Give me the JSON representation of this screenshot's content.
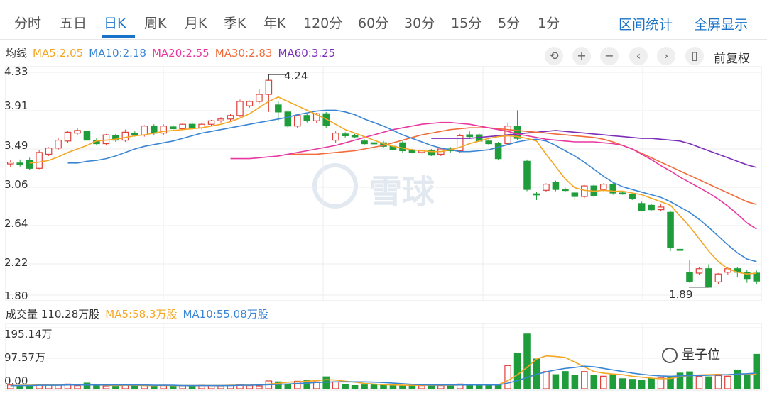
{
  "tabs": [
    {
      "label": "分时"
    },
    {
      "label": "五日"
    },
    {
      "label": "日K"
    },
    {
      "label": "周K"
    },
    {
      "label": "月K"
    },
    {
      "label": "季K"
    },
    {
      "label": "年K"
    },
    {
      "label": "120分"
    },
    {
      "label": "60分"
    },
    {
      "label": "30分"
    },
    {
      "label": "15分"
    },
    {
      "label": "5分"
    },
    {
      "label": "1分"
    }
  ],
  "active_tab": "日K",
  "links": {
    "interval_stats": "区间统计",
    "fullscreen": "全屏显示"
  },
  "ma_legend": {
    "title": "均线",
    "ma5": "MA5:2.05",
    "ma10": "MA10:2.18",
    "ma20": "MA20:2.55",
    "ma30": "MA30:2.83",
    "ma60": "MA60:3.25"
  },
  "colors": {
    "ma5": "#f5a623",
    "ma10": "#3b86d4",
    "ma20": "#e8379f",
    "ma30": "#f26b3a",
    "ma60": "#7b2fb8",
    "up": "#e0413a",
    "down": "#1f9d3a",
    "accent": "#1a73c9"
  },
  "toolbar": {
    "reset_glyph": "⟲",
    "zoom_in_glyph": "+",
    "zoom_out_glyph": "−",
    "prev_glyph": "‹",
    "next_glyph": "›",
    "bar_glyph": "▯",
    "adjust_label": "前复权"
  },
  "price_axis": [
    "4.33",
    "3.91",
    "3.49",
    "3.06",
    "2.64",
    "2.22",
    "1.80"
  ],
  "annotations": {
    "high": "4.24",
    "low": "1.89"
  },
  "volume_header": {
    "label": "成交量 110.28万股",
    "ma5": "MA5:58.3万股",
    "ma10": "MA10:55.08万股"
  },
  "volume_axis": [
    "195.14万",
    "97.57万",
    "0.00"
  ],
  "watermark": "雪球",
  "brand": "量子位",
  "chart_data": {
    "type": "candlestick",
    "ylim": [
      1.8,
      4.33
    ],
    "candles": [
      [
        3.29,
        3.31,
        3.27,
        3.25,
        3.33
      ],
      [
        3.3,
        3.28,
        3.33,
        3.26,
        3.34
      ],
      [
        3.33,
        3.24,
        3.35,
        3.22,
        3.36
      ],
      [
        3.24,
        3.42,
        3.24,
        3.23,
        3.45
      ],
      [
        3.4,
        3.47,
        3.39,
        3.38,
        3.48
      ],
      [
        3.47,
        3.56,
        3.46,
        3.45,
        3.58
      ],
      [
        3.55,
        3.65,
        3.54,
        3.53,
        3.66
      ],
      [
        3.64,
        3.67,
        3.63,
        3.62,
        3.7
      ],
      [
        3.66,
        3.56,
        3.68,
        3.4,
        3.69
      ],
      [
        3.56,
        3.52,
        3.57,
        3.5,
        3.58
      ],
      [
        3.52,
        3.62,
        3.51,
        3.5,
        3.63
      ],
      [
        3.61,
        3.56,
        3.62,
        3.54,
        3.63
      ],
      [
        3.56,
        3.65,
        3.55,
        3.54,
        3.68
      ],
      [
        3.64,
        3.62,
        3.65,
        3.6,
        3.66
      ],
      [
        3.62,
        3.72,
        3.61,
        3.6,
        3.73
      ],
      [
        3.72,
        3.64,
        3.73,
        3.62,
        3.74
      ],
      [
        3.64,
        3.72,
        3.63,
        3.62,
        3.74
      ],
      [
        3.71,
        3.69,
        3.72,
        3.67,
        3.73
      ],
      [
        3.69,
        3.74,
        3.68,
        3.67,
        3.75
      ],
      [
        3.74,
        3.7,
        3.75,
        3.68,
        3.77
      ],
      [
        3.7,
        3.74,
        3.69,
        3.68,
        3.76
      ],
      [
        3.74,
        3.78,
        3.73,
        3.72,
        3.79
      ],
      [
        3.78,
        3.8,
        3.77,
        3.76,
        3.82
      ],
      [
        3.8,
        3.84,
        3.79,
        3.78,
        3.86
      ],
      [
        3.84,
        4.0,
        3.83,
        3.82,
        4.02
      ],
      [
        3.95,
        4.0,
        3.94,
        3.93,
        4.01
      ],
      [
        4.0,
        4.08,
        3.99,
        3.98,
        4.14
      ],
      [
        4.08,
        4.24,
        3.9,
        3.88,
        4.24
      ],
      [
        3.96,
        3.88,
        3.97,
        3.78,
        4.0
      ],
      [
        3.88,
        3.72,
        3.89,
        3.7,
        3.9
      ],
      [
        3.72,
        3.84,
        3.71,
        3.7,
        3.86
      ],
      [
        3.84,
        3.78,
        3.85,
        3.76,
        3.86
      ],
      [
        3.78,
        3.86,
        3.77,
        3.75,
        3.87
      ],
      [
        3.86,
        3.73,
        3.87,
        3.7,
        3.88
      ],
      [
        3.56,
        3.64,
        3.55,
        3.53,
        3.66
      ],
      [
        3.63,
        3.61,
        3.64,
        3.59,
        3.65
      ],
      [
        3.61,
        3.6,
        3.62,
        3.58,
        3.63
      ],
      [
        3.55,
        3.52,
        3.56,
        3.5,
        3.57
      ],
      [
        3.53,
        3.52,
        3.54,
        3.44,
        3.55
      ],
      [
        3.53,
        3.49,
        3.54,
        3.47,
        3.55
      ],
      [
        3.49,
        3.45,
        3.5,
        3.43,
        3.51
      ],
      [
        3.53,
        3.44,
        3.54,
        3.42,
        3.55
      ],
      [
        3.44,
        3.42,
        3.45,
        3.41,
        3.46
      ],
      [
        3.42,
        3.44,
        3.43,
        3.41,
        3.45
      ],
      [
        3.44,
        3.39,
        3.45,
        3.38,
        3.46
      ],
      [
        3.4,
        3.46,
        3.39,
        3.38,
        3.47
      ],
      [
        3.46,
        3.44,
        3.47,
        3.42,
        3.48
      ],
      [
        3.44,
        3.61,
        3.43,
        3.42,
        3.63
      ],
      [
        3.62,
        3.6,
        3.63,
        3.58,
        3.66
      ],
      [
        3.62,
        3.55,
        3.63,
        3.54,
        3.64
      ],
      [
        3.55,
        3.52,
        3.56,
        3.5,
        3.57
      ],
      [
        3.52,
        3.35,
        3.53,
        3.33,
        3.54
      ],
      [
        3.52,
        3.72,
        3.51,
        3.5,
        3.76
      ],
      [
        3.72,
        3.58,
        3.73,
        3.56,
        3.9
      ],
      [
        3.32,
        3.0,
        3.33,
        2.98,
        3.34
      ],
      [
        2.95,
        2.94,
        2.96,
        2.88,
        2.97
      ],
      [
        2.99,
        3.06,
        2.98,
        2.97,
        3.07
      ],
      [
        3.08,
        3.0,
        3.09,
        2.98,
        3.1
      ],
      [
        3.0,
        2.99,
        3.01,
        2.97,
        3.02
      ],
      [
        2.96,
        2.92,
        2.97,
        2.88,
        2.98
      ],
      [
        2.92,
        3.04,
        2.91,
        2.9,
        3.05
      ],
      [
        3.04,
        2.93,
        3.05,
        2.91,
        3.06
      ],
      [
        3.0,
        3.06,
        2.99,
        2.98,
        3.07
      ],
      [
        3.06,
        2.96,
        3.07,
        2.94,
        3.08
      ],
      [
        2.96,
        2.95,
        2.97,
        2.94,
        2.98
      ],
      [
        2.94,
        2.9,
        2.95,
        2.88,
        2.96
      ],
      [
        2.84,
        2.76,
        2.85,
        2.75,
        2.86
      ],
      [
        2.82,
        2.77,
        2.83,
        2.76,
        2.84
      ],
      [
        2.77,
        2.8,
        2.76,
        2.75,
        2.83
      ],
      [
        2.74,
        2.34,
        2.75,
        2.3,
        2.76
      ],
      [
        2.32,
        2.31,
        2.33,
        2.1,
        2.34
      ],
      [
        2.06,
        1.95,
        2.07,
        1.94,
        2.2
      ],
      [
        2.05,
        2.1,
        2.04,
        2.03,
        2.12
      ],
      [
        2.1,
        1.89,
        2.11,
        1.89,
        2.15
      ],
      [
        1.95,
        2.04,
        1.94,
        1.92,
        2.05
      ],
      [
        2.06,
        2.1,
        2.05,
        2.03,
        2.12
      ],
      [
        2.1,
        2.06,
        2.09,
        2.0,
        2.12
      ],
      [
        2.06,
        1.98,
        2.07,
        1.94,
        2.09
      ],
      [
        2.05,
        1.96,
        2.06,
        1.92,
        2.08
      ]
    ],
    "ma": {
      "ma5": [
        3.3,
        3.31,
        3.33,
        3.37,
        3.42,
        3.46,
        3.5,
        3.55,
        3.56,
        3.57,
        3.59,
        3.61,
        3.62,
        3.64,
        3.66,
        3.67,
        3.68,
        3.69,
        3.7,
        3.72,
        3.74,
        3.77,
        3.81,
        3.86,
        3.93,
        4.0,
        4.05,
        4.0,
        3.95,
        3.9,
        3.85,
        3.8,
        3.74,
        3.68,
        3.64,
        3.6,
        3.56,
        3.52,
        3.49,
        3.47,
        3.45,
        3.44,
        3.43,
        3.43,
        3.45,
        3.48,
        3.52,
        3.55,
        3.58,
        3.6,
        3.61,
        3.6,
        3.58,
        3.55,
        3.4,
        3.26,
        3.12,
        3.02,
        2.99,
        2.98,
        2.99,
        2.98,
        2.98,
        2.96,
        2.94,
        2.9,
        2.86,
        2.82,
        2.7,
        2.58,
        2.44,
        2.3,
        2.18,
        2.1,
        2.06,
        2.04,
        2.05
      ],
      "ma10": [
        3.3,
        3.3,
        3.32,
        3.33,
        3.35,
        3.38,
        3.42,
        3.46,
        3.49,
        3.51,
        3.53,
        3.55,
        3.58,
        3.61,
        3.64,
        3.66,
        3.68,
        3.7,
        3.72,
        3.74,
        3.76,
        3.78,
        3.8,
        3.82,
        3.85,
        3.87,
        3.89,
        3.9,
        3.9,
        3.88,
        3.85,
        3.8,
        3.76,
        3.72,
        3.67,
        3.62,
        3.58,
        3.54,
        3.5,
        3.47,
        3.45,
        3.43,
        3.43,
        3.44,
        3.45,
        3.48,
        3.51,
        3.54,
        3.56,
        3.57,
        3.55,
        3.5,
        3.44,
        3.38,
        3.31,
        3.23,
        3.15,
        3.08,
        3.03,
        3.0,
        2.97,
        2.94,
        2.91,
        2.86,
        2.8,
        2.74,
        2.66,
        2.57,
        2.47,
        2.37,
        2.28,
        2.21,
        2.18
      ],
      "ma20": [
        3.35,
        3.35,
        3.35,
        3.36,
        3.37,
        3.38,
        3.4,
        3.42,
        3.44,
        3.46,
        3.48,
        3.5,
        3.53,
        3.56,
        3.59,
        3.62,
        3.65,
        3.68,
        3.7,
        3.72,
        3.74,
        3.75,
        3.76,
        3.76,
        3.75,
        3.74,
        3.72,
        3.7,
        3.68,
        3.66,
        3.63,
        3.61,
        3.59,
        3.57,
        3.56,
        3.55,
        3.54,
        3.54,
        3.54,
        3.53,
        3.52,
        3.5,
        3.46,
        3.4,
        3.34,
        3.27,
        3.21,
        3.14,
        3.08,
        3.02,
        2.96,
        2.89,
        2.81,
        2.72,
        2.62,
        2.55
      ],
      "ma30": [
        3.4,
        3.4,
        3.4,
        3.4,
        3.41,
        3.42,
        3.43,
        3.44,
        3.46,
        3.48,
        3.5,
        3.53,
        3.56,
        3.59,
        3.62,
        3.64,
        3.66,
        3.68,
        3.69,
        3.7,
        3.7,
        3.7,
        3.69,
        3.68,
        3.67,
        3.66,
        3.65,
        3.64,
        3.63,
        3.62,
        3.61,
        3.6,
        3.59,
        3.57,
        3.54,
        3.5,
        3.46,
        3.41,
        3.36,
        3.31,
        3.26,
        3.21,
        3.16,
        3.11,
        3.06,
        3.01,
        2.96,
        2.91,
        2.86,
        2.83
      ],
      "ma60": [
        3.58,
        3.58,
        3.58,
        3.58,
        3.58,
        3.59,
        3.6,
        3.61,
        3.62,
        3.63,
        3.64,
        3.65,
        3.66,
        3.67,
        3.66,
        3.65,
        3.64,
        3.63,
        3.62,
        3.61,
        3.6,
        3.59,
        3.58,
        3.58,
        3.57,
        3.56,
        3.55,
        3.52,
        3.48,
        3.44,
        3.4,
        3.36,
        3.32,
        3.28,
        3.25
      ]
    },
    "volume": [
      12,
      11,
      10,
      14,
      13,
      12,
      15,
      10,
      18,
      9,
      9,
      8,
      14,
      10,
      11,
      9,
      10,
      9,
      10,
      9,
      11,
      10,
      9,
      11,
      14,
      10,
      9,
      25,
      22,
      15,
      24,
      26,
      22,
      38,
      22,
      14,
      10,
      12,
      12,
      12,
      12,
      9,
      12,
      10,
      13,
      10,
      12,
      15,
      12,
      13,
      11,
      12,
      74,
      112,
      175,
      95,
      55,
      45,
      55,
      43,
      55,
      42,
      40,
      45,
      32,
      30,
      28,
      33,
      36,
      35,
      50,
      54,
      40,
      38,
      42,
      40,
      60,
      45,
      110
    ],
    "volume_ma5": [
      10,
      11,
      11,
      12,
      12,
      12,
      13,
      12,
      13,
      12,
      11,
      10,
      11,
      11,
      10,
      10,
      11,
      10,
      10,
      10,
      10,
      10,
      10,
      11,
      11,
      11,
      13,
      15,
      17,
      21,
      22,
      24,
      26,
      29,
      28,
      24,
      21,
      17,
      15,
      13,
      12,
      11,
      11,
      11,
      11,
      11,
      11,
      12,
      12,
      13,
      13,
      13,
      26,
      45,
      68,
      95,
      105,
      103,
      100,
      85,
      70,
      55,
      50,
      47,
      45,
      40,
      37,
      34,
      32,
      33,
      38,
      42,
      44,
      45,
      46,
      44,
      46,
      45,
      47
    ],
    "volume_ma10": [
      10,
      10,
      10,
      11,
      11,
      11,
      12,
      12,
      12,
      12,
      12,
      12,
      12,
      12,
      12,
      11,
      11,
      11,
      10,
      10,
      10,
      10,
      10,
      10,
      11,
      11,
      12,
      13,
      14,
      15,
      17,
      18,
      20,
      21,
      22,
      22,
      22,
      22,
      21,
      20,
      18,
      16,
      14,
      13,
      12,
      12,
      12,
      12,
      12,
      12,
      12,
      12,
      18,
      26,
      36,
      46,
      54,
      60,
      65,
      68,
      72,
      70,
      65,
      60,
      55,
      50,
      46,
      43,
      41,
      40,
      41,
      42,
      42,
      43,
      44,
      45,
      47,
      48,
      50
    ]
  }
}
